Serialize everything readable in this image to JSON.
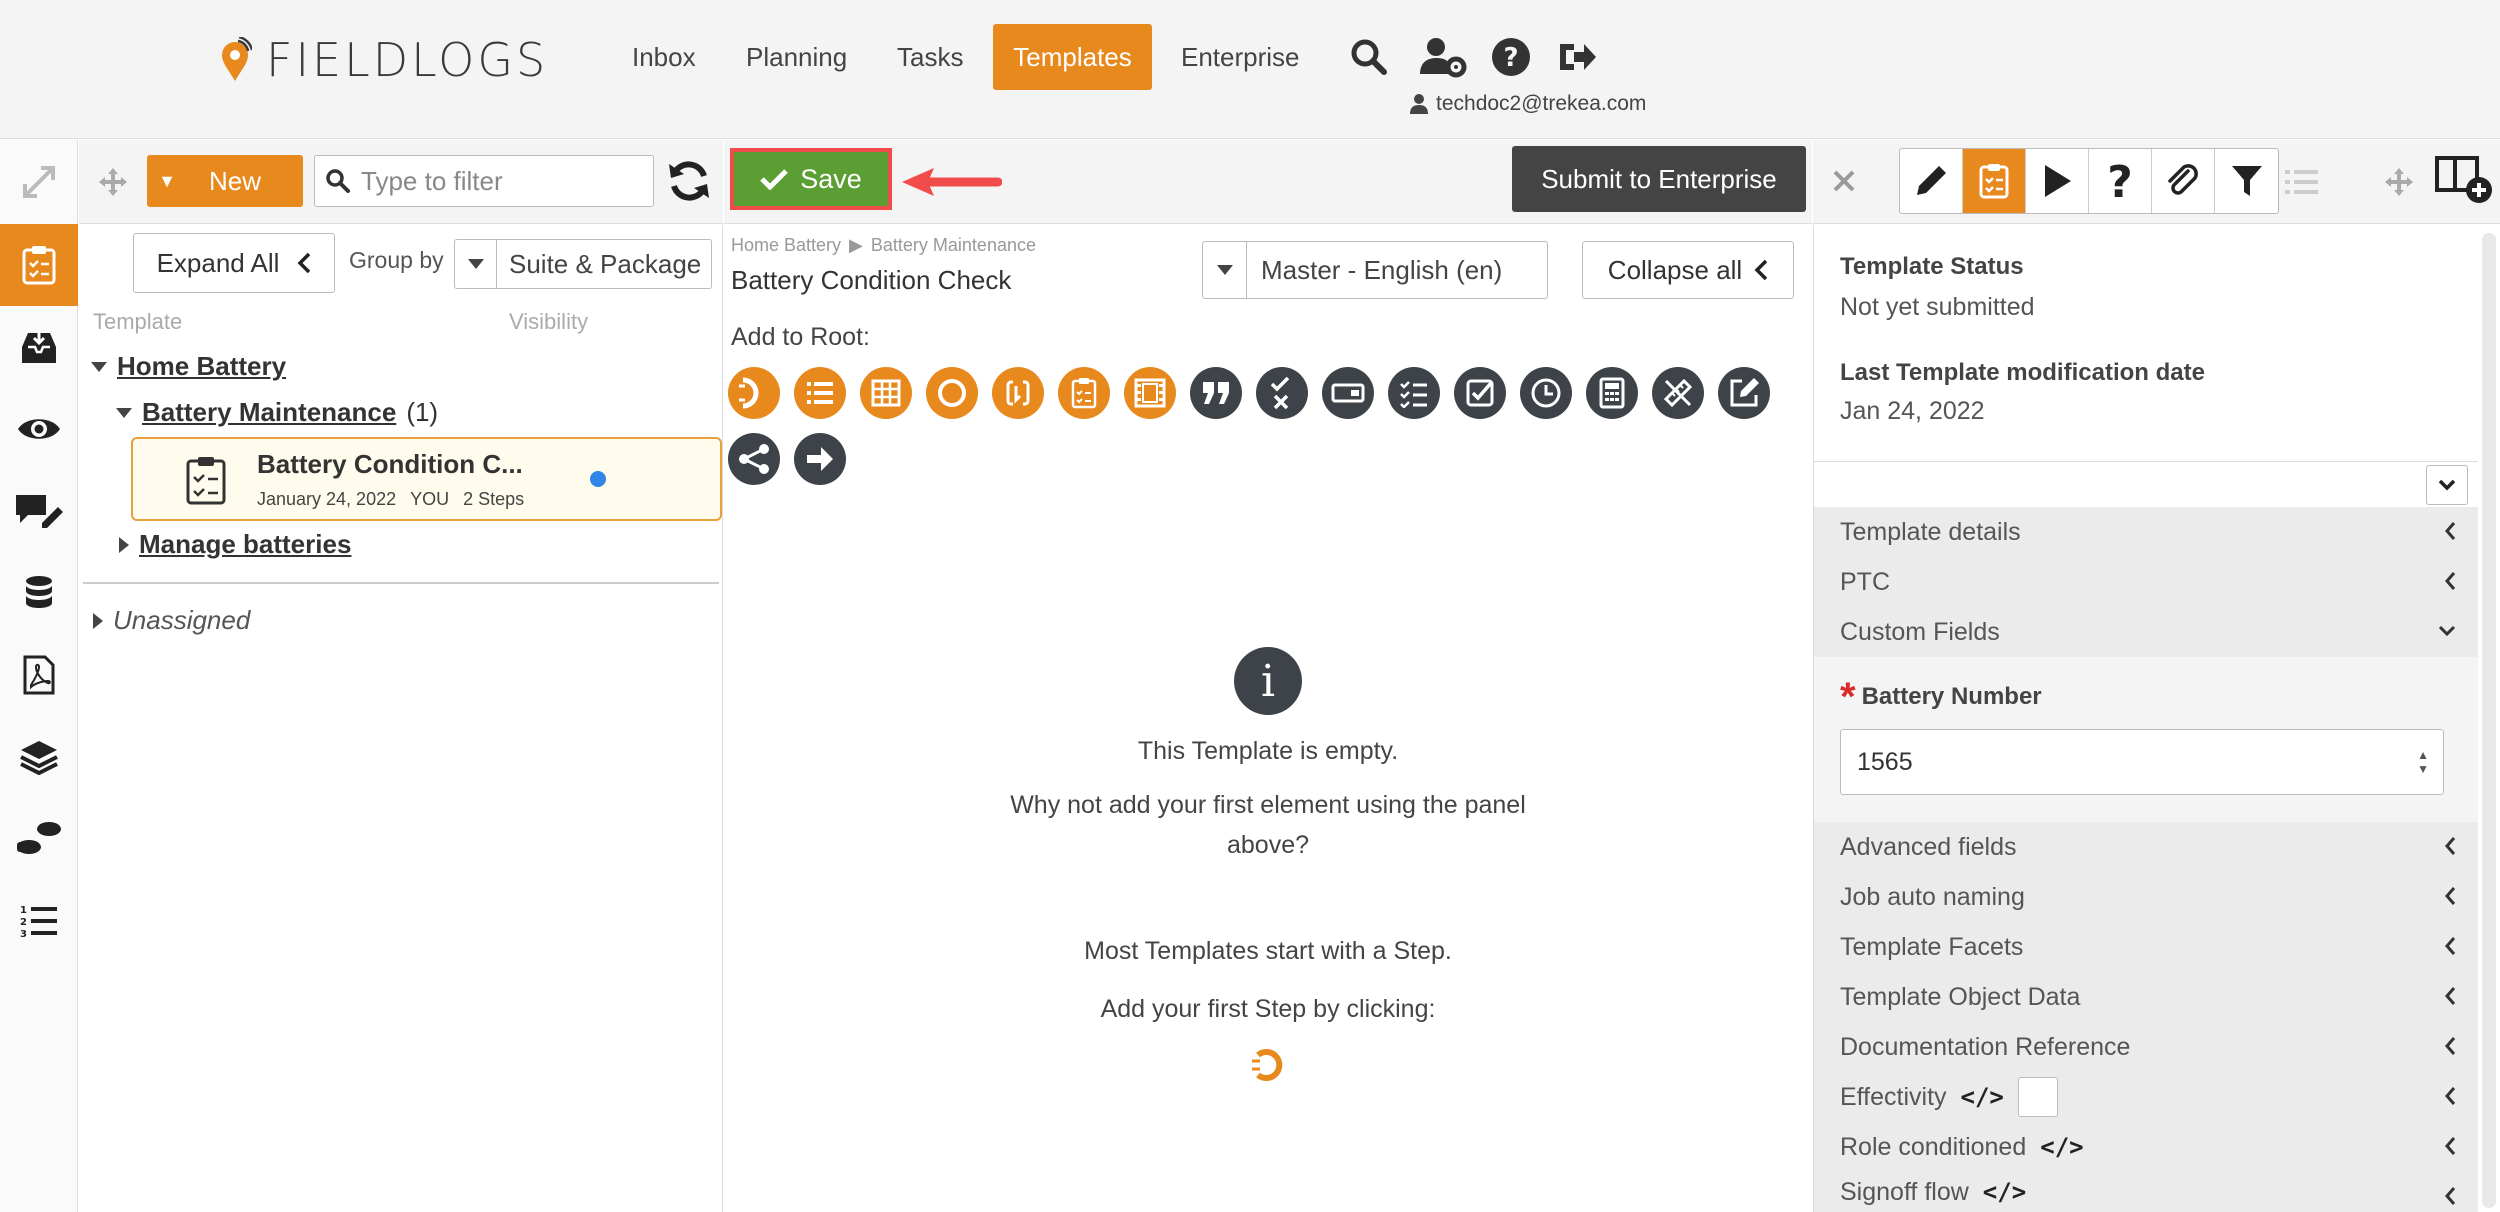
{
  "brand": {
    "name": "FIELDLOGS",
    "accent": "#e8891e"
  },
  "nav": {
    "items": [
      {
        "id": "inbox",
        "label": "Inbox"
      },
      {
        "id": "planning",
        "label": "Planning"
      },
      {
        "id": "tasks",
        "label": "Tasks"
      },
      {
        "id": "templates",
        "label": "Templates"
      },
      {
        "id": "enterprise",
        "label": "Enterprise"
      }
    ],
    "active": "Templates",
    "user_email": "techdoc2@trekea.com"
  },
  "tree_toolbar": {
    "new_label": "New",
    "filter_placeholder": "Type to filter"
  },
  "editor_toolbar": {
    "save_label": "Save",
    "submit_label": "Submit to Enterprise"
  },
  "tree": {
    "expand_all_label": "Expand All",
    "group_by_label": "Group by",
    "group_by_value": "Suite & Package",
    "col_template": "Template",
    "col_visibility": "Visibility",
    "suite": "Home Battery",
    "package": "Battery Maintenance",
    "package_count": "(1)",
    "item_title": "Battery Condition C...",
    "item_date": "January 24, 2022",
    "item_owner": "YOU",
    "item_steps": "2 Steps",
    "package2": "Manage batteries",
    "unassigned": "Unassigned"
  },
  "editor": {
    "crumb_1": "Home Battery",
    "crumb_sep": "▶",
    "crumb_2": "Battery Maintenance",
    "template_name": "Battery Condition Check",
    "language_value": "Master - English (en)",
    "collapse_all_label": "Collapse all",
    "add_to_root_label": "Add to Root:",
    "empty_title": "This Template is empty.",
    "empty_line_1": "Why not add your first element using the panel",
    "empty_line_2": "above?",
    "empty_hint_1": "Most Templates start with a Step.",
    "empty_hint_2": "Add your first Step by clicking:"
  },
  "properties": {
    "status_label": "Template Status",
    "status_value": "Not yet submitted",
    "modified_label": "Last Template modification date",
    "modified_value": "Jan 24, 2022",
    "sections": [
      "Template details",
      "PTC",
      "Custom Fields",
      "Advanced fields",
      "Job auto naming",
      "Template Facets",
      "Template Object Data",
      "Documentation Reference",
      "Effectivity",
      "Role conditioned",
      "Signoff flow"
    ],
    "battery_label": "Battery Number",
    "battery_value": "1565"
  }
}
